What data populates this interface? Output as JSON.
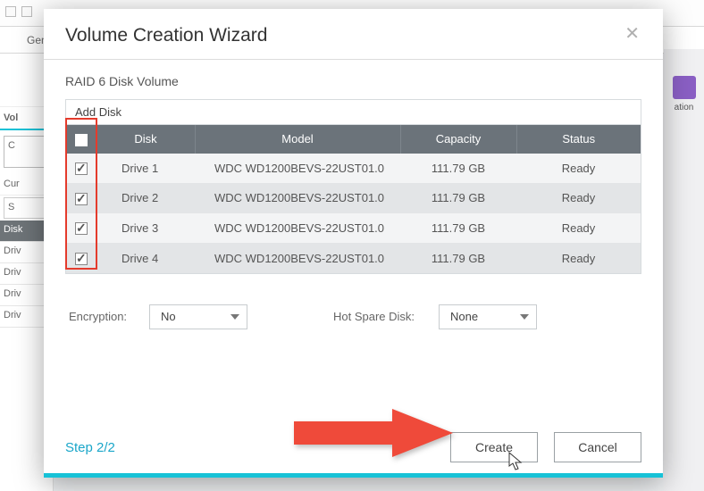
{
  "bg": {
    "tab_general": "Genera",
    "tab_right": "ation",
    "side_vol": "Vol",
    "side_c": "C",
    "side_cur": "Cur",
    "side_s": "S",
    "side_disk": "Disk",
    "side_drv": "Driv"
  },
  "modal": {
    "title": "Volume Creation Wizard",
    "subtitle": "RAID 6 Disk Volume",
    "add_disk": "Add Disk",
    "columns": {
      "disk": "Disk",
      "model": "Model",
      "capacity": "Capacity",
      "status": "Status"
    },
    "rows": [
      {
        "disk": "Drive 1",
        "model": "WDC WD1200BEVS-22UST01.0",
        "capacity": "111.79 GB",
        "status": "Ready",
        "checked": true
      },
      {
        "disk": "Drive 2",
        "model": "WDC WD1200BEVS-22UST01.0",
        "capacity": "111.79 GB",
        "status": "Ready",
        "checked": true
      },
      {
        "disk": "Drive 3",
        "model": "WDC WD1200BEVS-22UST01.0",
        "capacity": "111.79 GB",
        "status": "Ready",
        "checked": true
      },
      {
        "disk": "Drive 4",
        "model": "WDC WD1200BEVS-22UST01.0",
        "capacity": "111.79 GB",
        "status": "Ready",
        "checked": true
      }
    ],
    "header_checked": true,
    "encryption_label": "Encryption:",
    "encryption_value": "No",
    "hotspare_label": "Hot Spare Disk:",
    "hotspare_value": "None",
    "step": "Step 2/2",
    "create": "Create",
    "cancel": "Cancel"
  }
}
